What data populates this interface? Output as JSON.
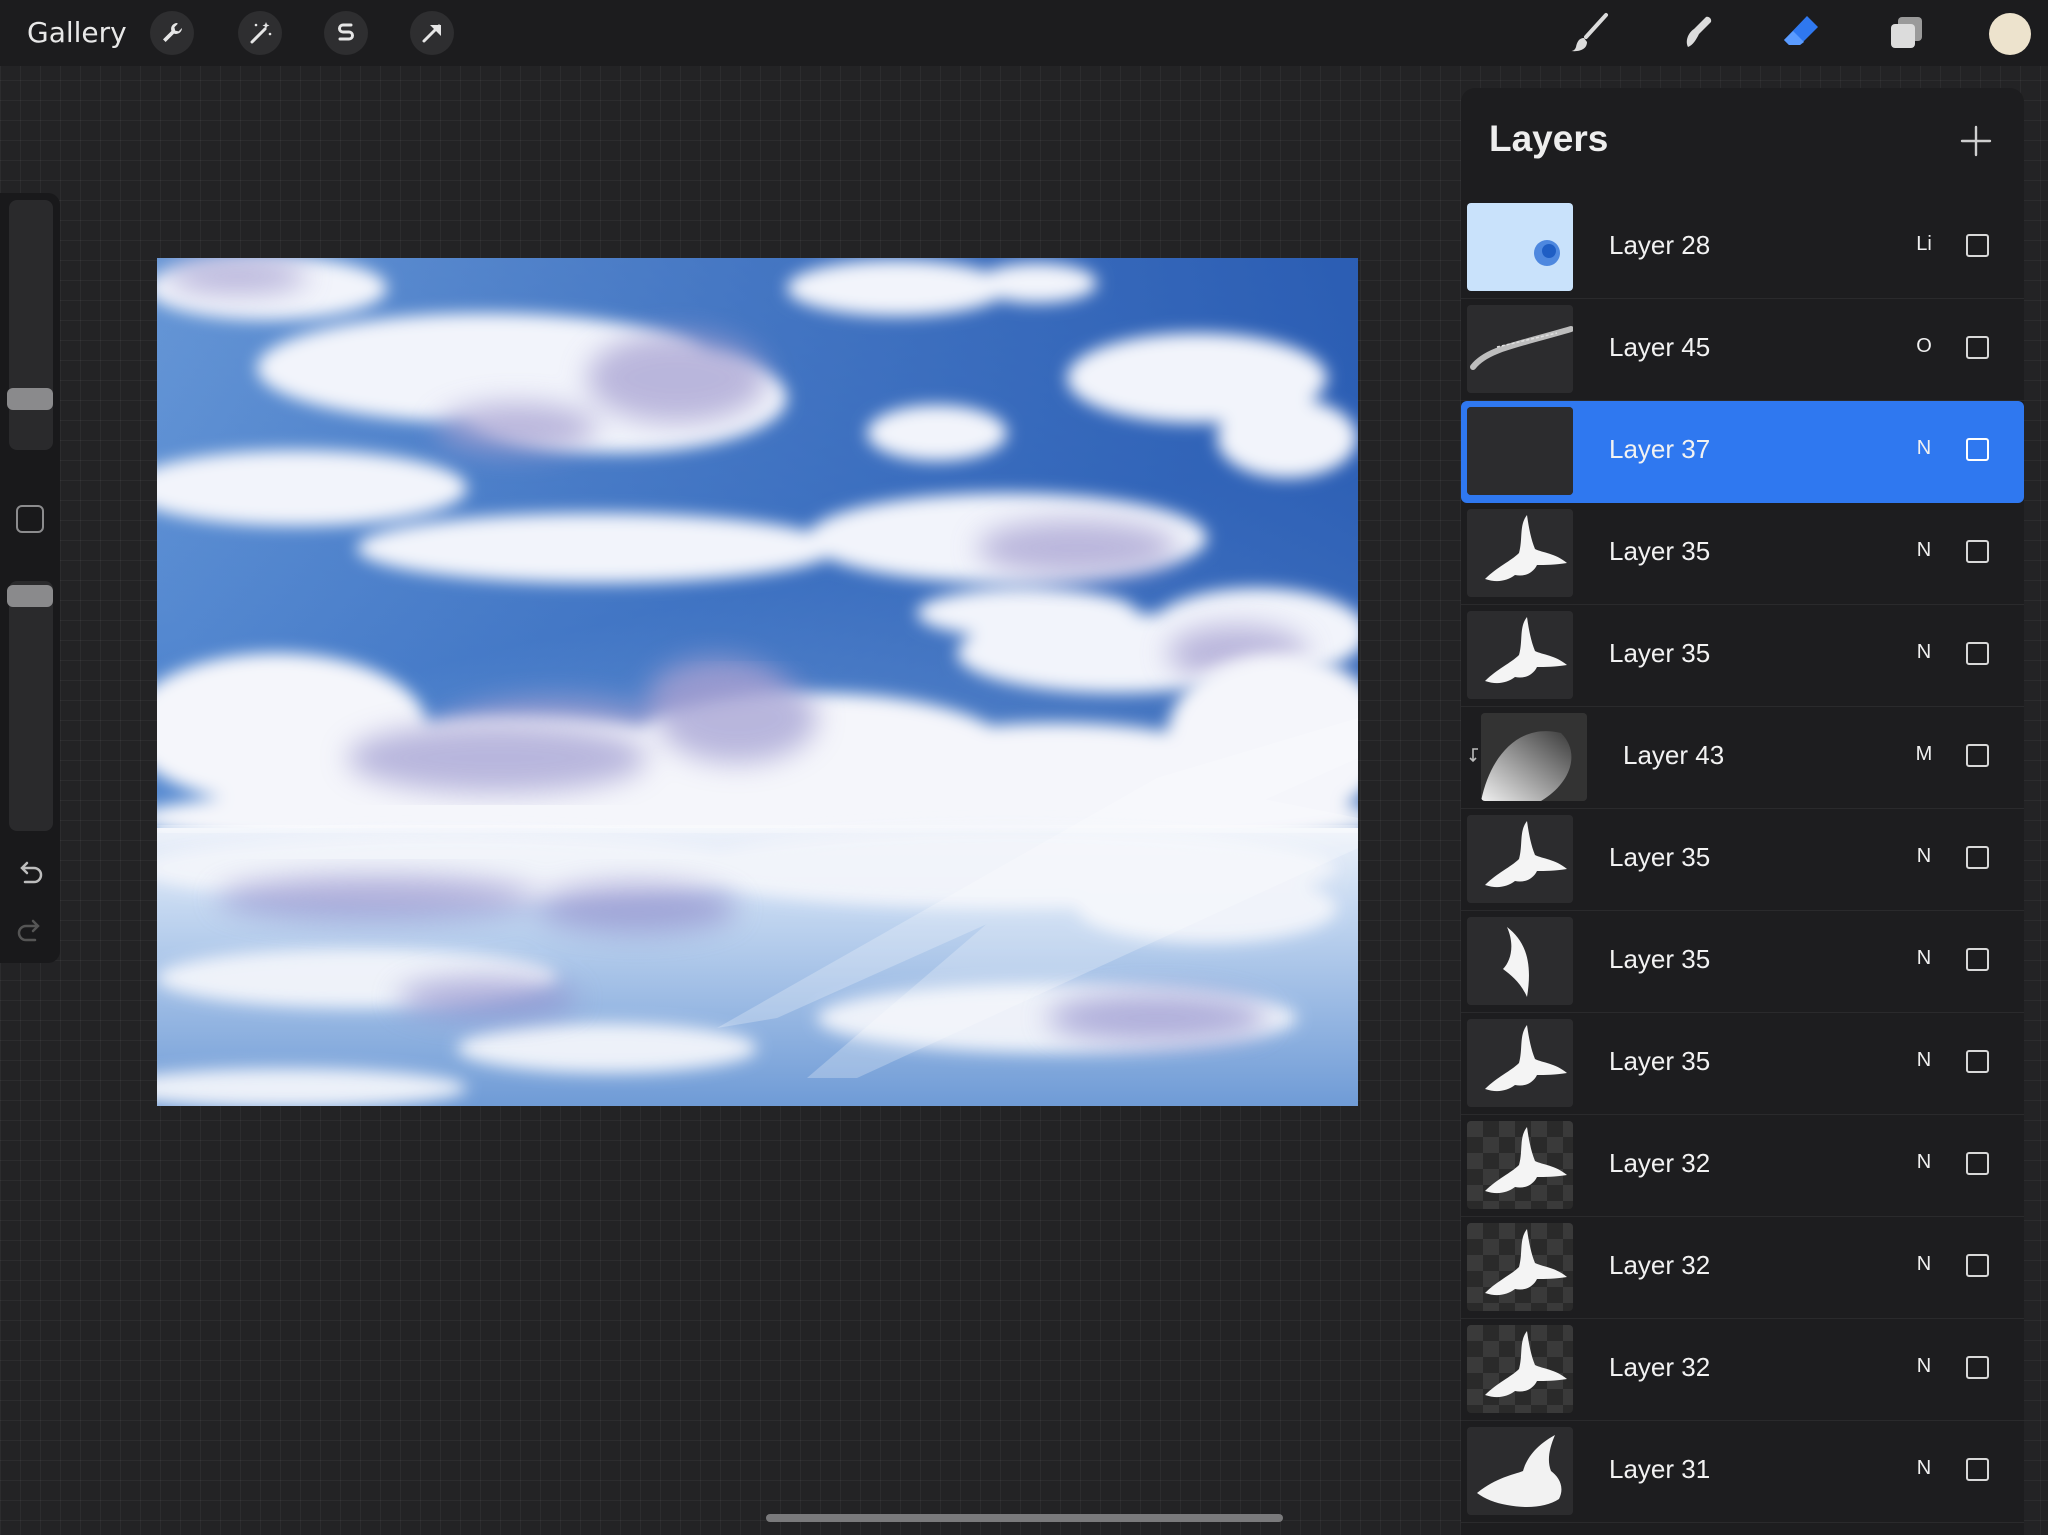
{
  "topbar": {
    "gallery_label": "Gallery",
    "left_tools": [
      "wrench-icon",
      "magic-wand-icon",
      "selection-icon",
      "transform-icon"
    ],
    "right_tools": [
      "brush-icon",
      "smudge-icon",
      "eraser-icon",
      "layers-icon"
    ],
    "active_tool": "eraser-icon",
    "color": "#ede3cd"
  },
  "sidebar": {
    "brush_size_level": 0.33,
    "opacity_level": 0.04
  },
  "layers_panel": {
    "title": "Layers",
    "layers": [
      {
        "name": "Layer 28",
        "mode": "Li",
        "visible": false,
        "thumb": "light-blue"
      },
      {
        "name": "Layer 45",
        "mode": "O",
        "visible": false,
        "thumb": "streak"
      },
      {
        "name": "Layer 37",
        "mode": "N",
        "visible": false,
        "thumb": "empty",
        "active": true
      },
      {
        "name": "Layer 35",
        "mode": "N",
        "visible": false,
        "thumb": "bird"
      },
      {
        "name": "Layer 35",
        "mode": "N",
        "visible": false,
        "thumb": "bird"
      },
      {
        "name": "Layer 43",
        "mode": "M",
        "visible": false,
        "thumb": "gradient",
        "clipped": true
      },
      {
        "name": "Layer 35",
        "mode": "N",
        "visible": false,
        "thumb": "bird"
      },
      {
        "name": "Layer 35",
        "mode": "N",
        "visible": false,
        "thumb": "wing"
      },
      {
        "name": "Layer 35",
        "mode": "N",
        "visible": false,
        "thumb": "bird"
      },
      {
        "name": "Layer 32",
        "mode": "N",
        "visible": false,
        "thumb": "bird-checker"
      },
      {
        "name": "Layer 32",
        "mode": "N",
        "visible": false,
        "thumb": "bird-checker"
      },
      {
        "name": "Layer 32",
        "mode": "N",
        "visible": false,
        "thumb": "bird-checker"
      },
      {
        "name": "Layer 31",
        "mode": "N",
        "visible": false,
        "thumb": "dove"
      }
    ]
  },
  "colors": {
    "accent": "#2f78f0",
    "sky_top": "#2c5fb4",
    "sky_mid": "#6c9bd9",
    "cloud": "#f4f5fa",
    "cloud_shadow": "#a9a4d0"
  }
}
